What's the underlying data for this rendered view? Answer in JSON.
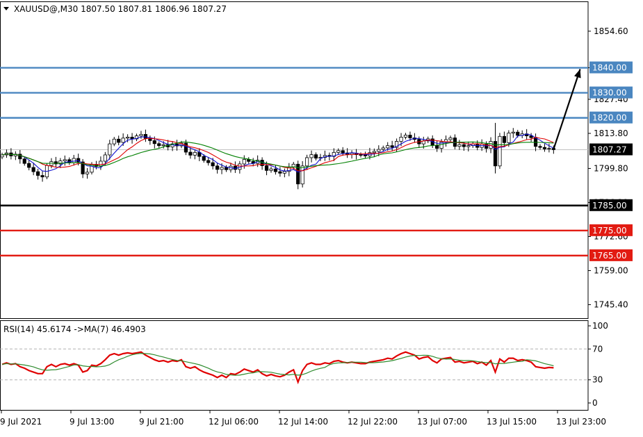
{
  "header": {
    "symbol_line": "XAUUSD@,M30  1807.50 1807.81 1806.96 1807.27",
    "indicator_line": "RSI(14) 45.6174  ->MA(7) 46.4903"
  },
  "colors": {
    "background": "#ffffff",
    "bull_candle": "#ffffff",
    "bear_candle": "#000000",
    "ma_fast": "#1010d0",
    "ma_mid": "#e00000",
    "ma_slow": "#008000",
    "resistance_line": "#4a86c0",
    "pivot_line": "#000000",
    "support_line": "#e21b12",
    "rsi_line": "#e00000",
    "rsi_ma": "#2e8b2e",
    "arrow": "#000000"
  },
  "chart_data": [
    {
      "type": "candlestick",
      "title": "XAUUSD@,M30",
      "timeframe": "M30",
      "ohlc_current": {
        "open": 1807.5,
        "high": 1807.81,
        "low": 1806.96,
        "close": 1807.27
      },
      "ylim": [
        1740.0,
        1866.5
      ],
      "y_ticks": [
        "1854.60",
        "1840.00",
        "1827.40",
        "1813.80",
        "1799.80",
        "1786.20",
        "1772.60",
        "1759.00",
        "1745.40"
      ],
      "x_ticks": [
        "9 Jul 2021",
        "9 Jul 13:00",
        "9 Jul 21:00",
        "12 Jul 06:00",
        "12 Jul 14:00",
        "12 Jul 22:00",
        "13 Jul 07:00",
        "13 Jul 15:00",
        "13 Jul 23:00"
      ],
      "current_price_label": "1807.27",
      "levels": [
        {
          "label": "1840.00",
          "value": 1840.0,
          "kind": "resistance"
        },
        {
          "label": "1830.00",
          "value": 1830.0,
          "kind": "resistance"
        },
        {
          "label": "1820.00",
          "value": 1820.0,
          "kind": "resistance"
        },
        {
          "label": "1785.00",
          "value": 1785.0,
          "kind": "pivot"
        },
        {
          "label": "1775.00",
          "value": 1775.0,
          "kind": "support"
        },
        {
          "label": "1765.00",
          "value": 1765.0,
          "kind": "support"
        }
      ],
      "arrow": {
        "from": {
          "bar": 123,
          "price": 1807.5
        },
        "to": {
          "bar": 128,
          "price": 1840.0
        }
      },
      "close_series": [
        1805.2,
        1806.0,
        1804.8,
        1805.5,
        1803.6,
        1801.8,
        1800.2,
        1798.5,
        1797.0,
        1796.4,
        1801.0,
        1802.5,
        1801.6,
        1802.8,
        1803.3,
        1802.1,
        1803.8,
        1802.4,
        1797.6,
        1798.3,
        1801.4,
        1800.6,
        1802.7,
        1805.2,
        1809.6,
        1811.5,
        1810.2,
        1811.9,
        1812.3,
        1811.6,
        1812.8,
        1813.4,
        1811.8,
        1810.9,
        1809.7,
        1808.9,
        1809.3,
        1808.4,
        1809.6,
        1808.8,
        1809.9,
        1806.3,
        1805.1,
        1806.2,
        1804.6,
        1803.0,
        1802.1,
        1800.8,
        1799.4,
        1800.2,
        1799.3,
        1800.7,
        1799.4,
        1801.6,
        1803.4,
        1802.6,
        1801.8,
        1803.1,
        1800.9,
        1799.0,
        1799.6,
        1798.5,
        1797.9,
        1798.6,
        1800.3,
        1801.5,
        1793.6,
        1800.8,
        1804.1,
        1805.3,
        1803.9,
        1804.2,
        1805.0,
        1804.6,
        1806.2,
        1806.9,
        1806.0,
        1805.4,
        1805.9,
        1805.3,
        1805.1,
        1804.8,
        1806.1,
        1806.6,
        1807.4,
        1808.0,
        1808.9,
        1808.2,
        1810.6,
        1812.3,
        1813.1,
        1812.0,
        1811.4,
        1809.6,
        1810.8,
        1811.6,
        1809.1,
        1807.8,
        1810.4,
        1811.3,
        1812.0,
        1808.6,
        1809.3,
        1808.5,
        1808.9,
        1809.6,
        1808.2,
        1809.5,
        1807.8,
        1810.6,
        1800.8,
        1812.6,
        1810.1,
        1813.9,
        1814.3,
        1813.0,
        1813.6,
        1812.8,
        1812.1,
        1808.6,
        1808.2,
        1807.6,
        1807.8,
        1807.3
      ],
      "moving_averages": [
        {
          "name": "fast",
          "color": "#1010d0",
          "period": 5
        },
        {
          "name": "mid",
          "color": "#e00000",
          "period": 9
        },
        {
          "name": "slow",
          "color": "#008000",
          "period": 18
        }
      ]
    },
    {
      "type": "line",
      "title": "RSI(14) 45.6174  ->MA(7) 46.4903",
      "ylim": [
        0,
        100
      ],
      "y_ticks": [
        "100",
        "70",
        "30",
        "0"
      ],
      "levels": [
        70,
        30
      ],
      "series": [
        {
          "name": "RSI(14)",
          "color": "#e00000",
          "values": [
            50,
            52,
            50,
            51,
            47,
            45,
            42,
            40,
            38,
            38,
            47,
            50,
            47,
            50,
            51,
            49,
            51,
            49,
            40,
            42,
            49,
            48,
            51,
            56,
            62,
            64,
            62,
            64,
            65,
            64,
            65,
            66,
            62,
            59,
            56,
            54,
            55,
            53,
            55,
            54,
            56,
            47,
            45,
            47,
            43,
            40,
            38,
            36,
            33,
            36,
            33,
            38,
            37,
            40,
            44,
            42,
            40,
            43,
            38,
            35,
            37,
            35,
            34,
            36,
            40,
            43,
            27,
            42,
            50,
            52,
            50,
            50,
            52,
            51,
            54,
            55,
            53,
            52,
            53,
            52,
            51,
            51,
            53,
            54,
            55,
            56,
            58,
            57,
            61,
            64,
            66,
            64,
            62,
            57,
            59,
            60,
            55,
            52,
            57,
            58,
            59,
            53,
            54,
            52,
            53,
            54,
            51,
            53,
            49,
            55,
            40,
            57,
            53,
            58,
            58,
            55,
            56,
            55,
            53,
            47,
            46,
            45,
            46,
            45.6
          ]
        },
        {
          "name": "MA(7)",
          "color": "#2e8b2e",
          "period": 7
        }
      ]
    }
  ]
}
